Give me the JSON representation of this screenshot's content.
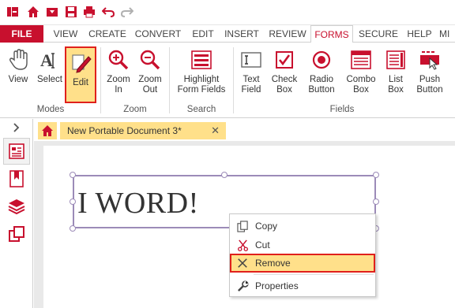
{
  "menu": {
    "file": "FILE",
    "tabs": [
      "VIEW",
      "CREATE",
      "CONVERT",
      "EDIT",
      "INSERT",
      "REVIEW",
      "FORMS",
      "SECURE",
      "HELP",
      "MI"
    ]
  },
  "ribbon": {
    "modes": {
      "label": "Modes",
      "view": "View",
      "select": "Select",
      "edit": "Edit"
    },
    "zoom": {
      "label": "Zoom",
      "zoom_in": "Zoom\nIn",
      "zoom_out": "Zoom\nOut"
    },
    "search": {
      "label": "Search",
      "highlight": "Highlight\nForm Fields"
    },
    "fields": {
      "label": "Fields",
      "text_field": "Text\nField",
      "check_box": "Check\nBox",
      "radio_button": "Radio\nButton",
      "combo_box": "Combo\nBox",
      "list_box": "List\nBox",
      "push_button": "Push\nButton"
    }
  },
  "document": {
    "tab_title": "New Portable Document 3*",
    "field_text": "I WORD!"
  },
  "context_menu": {
    "copy": "Copy",
    "cut": "Cut",
    "remove": "Remove",
    "properties": "Properties"
  },
  "colors": {
    "accent": "#c8102e",
    "selected": "#ffe08a",
    "highlight_border": "#e0201c"
  }
}
